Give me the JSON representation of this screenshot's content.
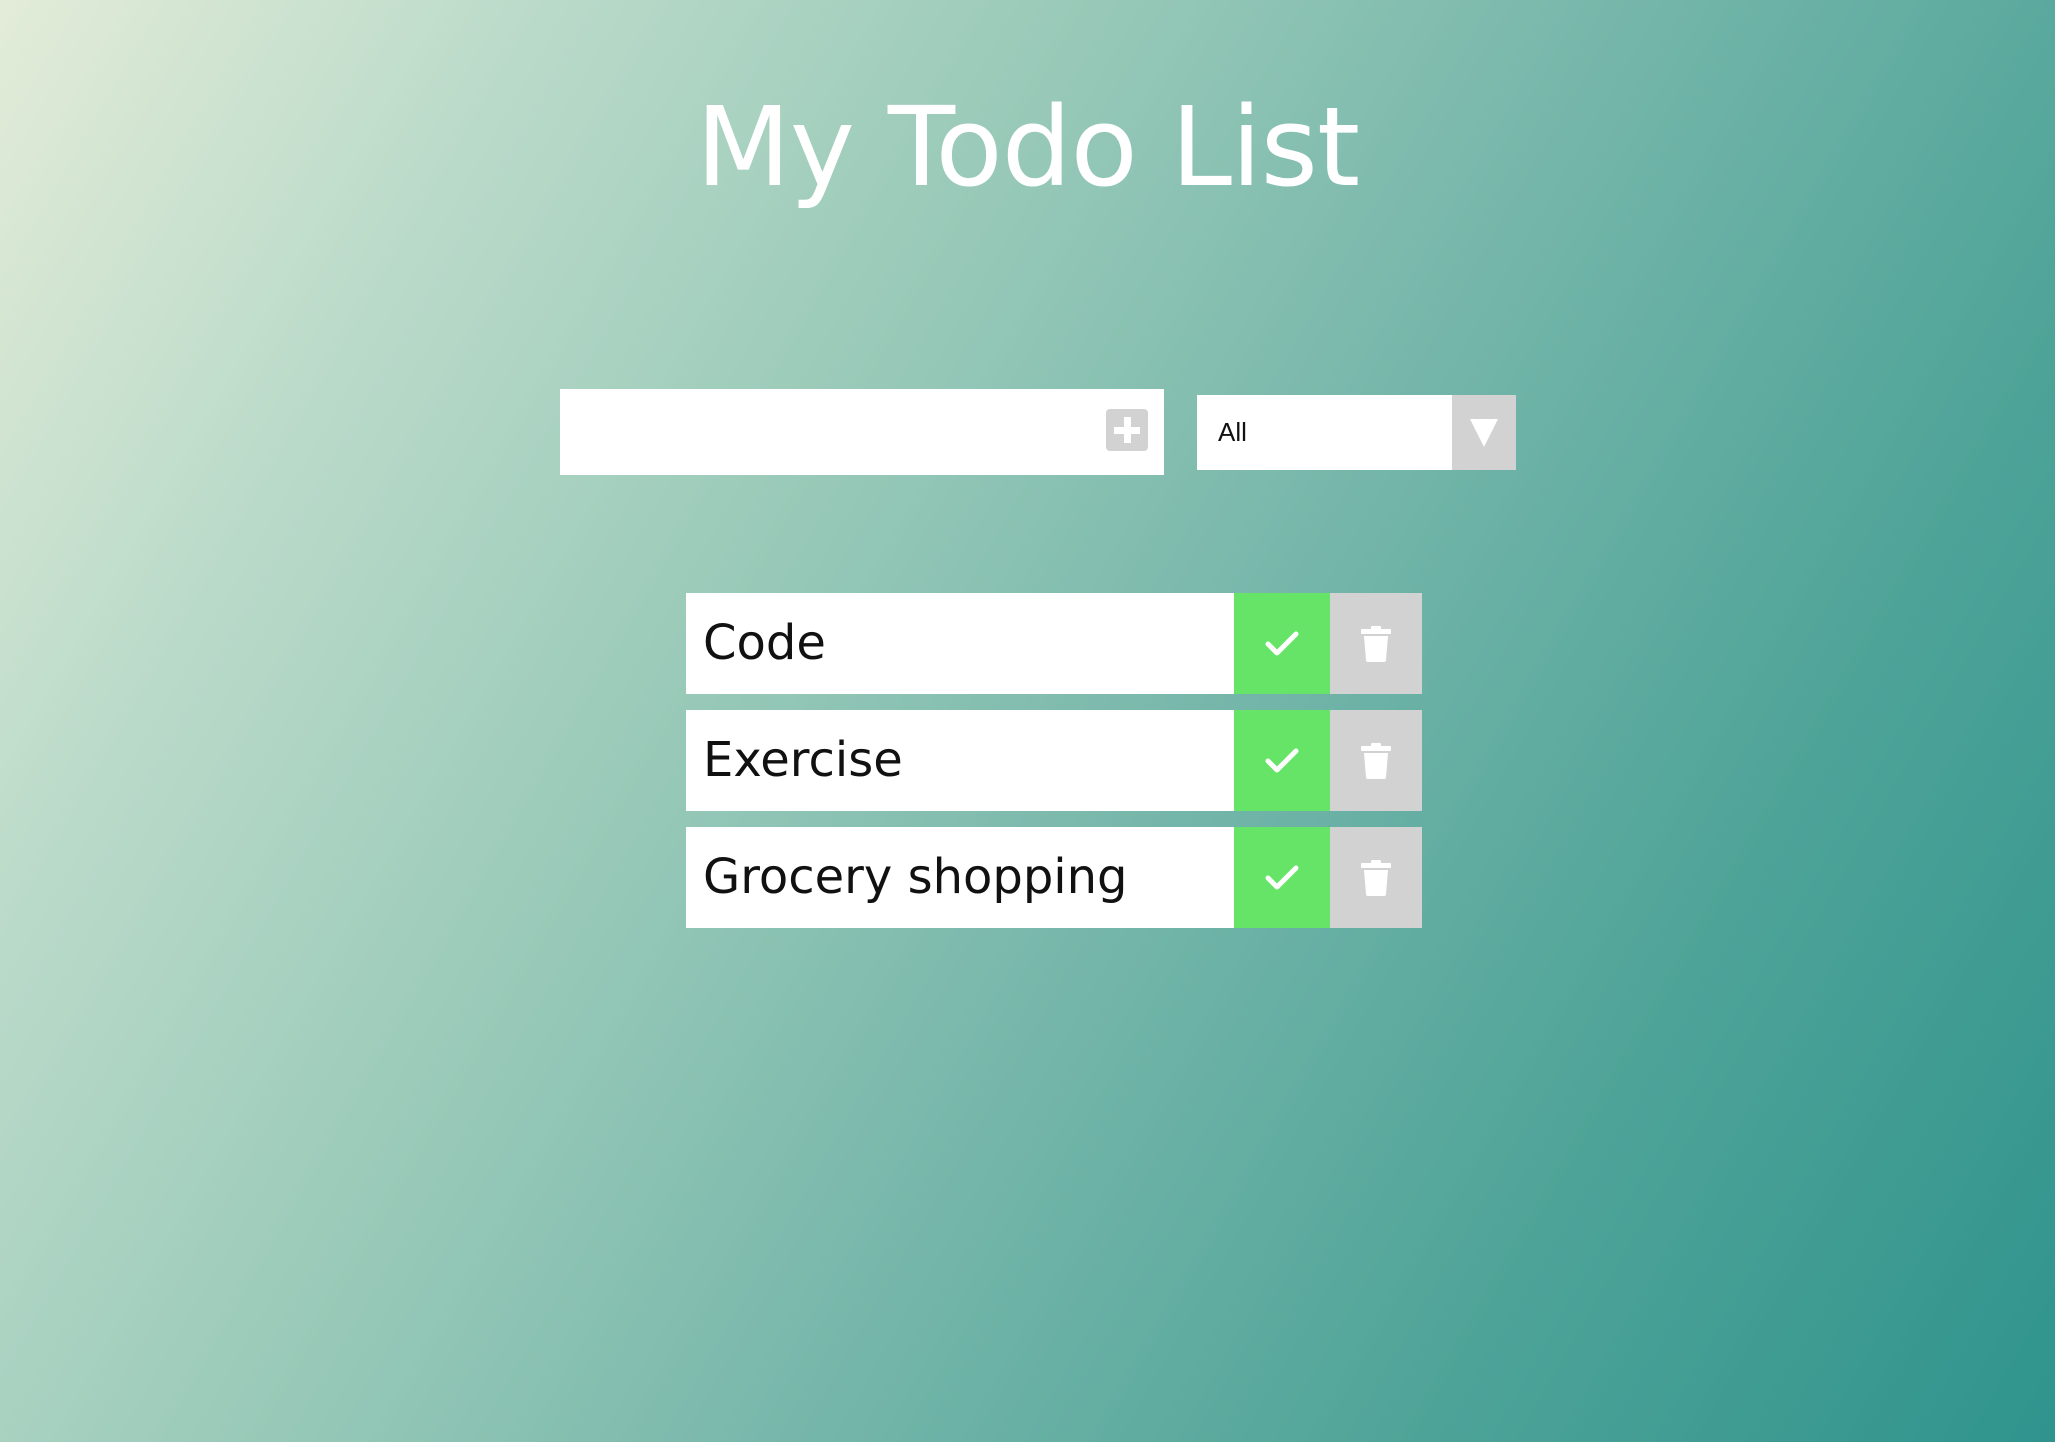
{
  "header": {
    "title": "My Todo List"
  },
  "form": {
    "input_value": "",
    "input_placeholder": "",
    "add_icon": "plus-square-icon",
    "filter": {
      "selected": "All",
      "arrow_icon": "caret-down-icon"
    }
  },
  "todos": [
    {
      "text": "Code",
      "complete_icon": "check-icon",
      "delete_icon": "trash-icon"
    },
    {
      "text": "Exercise",
      "complete_icon": "check-icon",
      "delete_icon": "trash-icon"
    },
    {
      "text": "Grocery shopping",
      "complete_icon": "check-icon",
      "delete_icon": "trash-icon"
    }
  ],
  "colors": {
    "gradient_start": "#e3ecd8",
    "gradient_end": "#2f948d",
    "complete": "#66e468",
    "delete": "#d2d2d2",
    "title": "#ffffff"
  }
}
